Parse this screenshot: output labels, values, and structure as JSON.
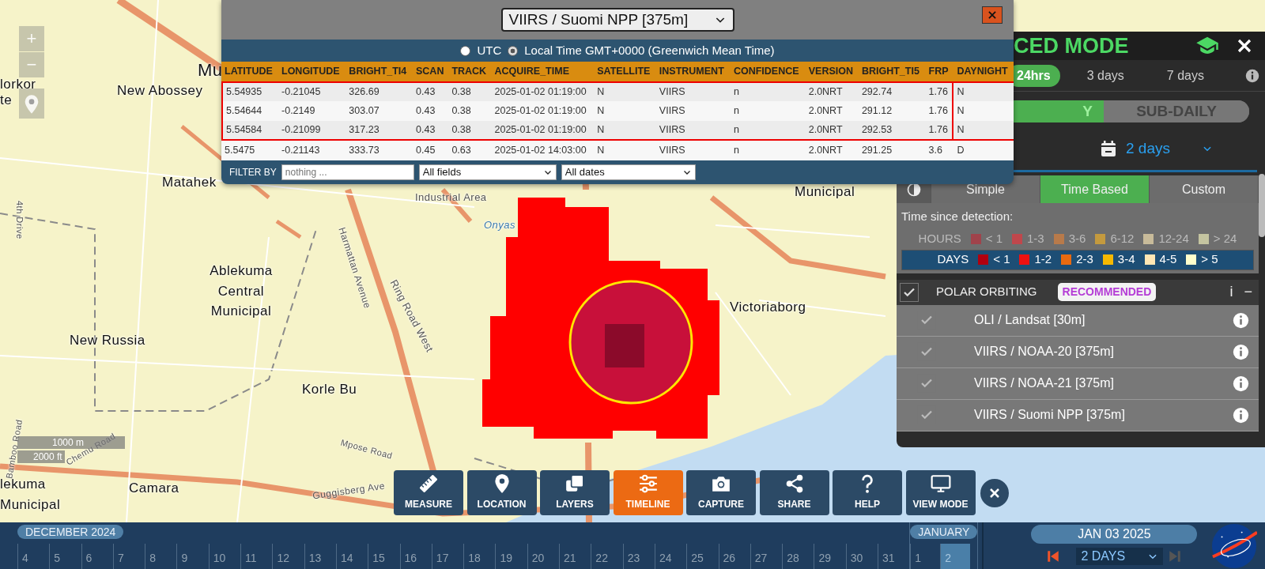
{
  "map": {
    "labels": [
      "Mu",
      "lorkor",
      "te",
      "New Abossey",
      "Matahek",
      "Ablekuma Central Municipal",
      "New Russia",
      "Korle Bu",
      "Camara",
      "lekuma Municipal",
      "Industrial Area",
      "Onyas",
      "Municipal",
      "Victoriaborg",
      "Ring Road West",
      "Harmattan Avenue",
      "4th Drive",
      "Chemu Road",
      "Mpose Road",
      "Guggisberg Ave",
      "Bamboo Road"
    ],
    "zoom_controls": [
      "+",
      "−"
    ],
    "scale": [
      "1000 m",
      "2000 ft"
    ]
  },
  "popup": {
    "source": "VIIRS / Suomi NPP [375m]",
    "time_modes": [
      {
        "label": "UTC",
        "selected": false
      },
      {
        "label": "Local Time GMT+0000 (Greenwich Mean Time)",
        "selected": true
      }
    ],
    "columns": [
      "LATITUDE",
      "LONGITUDE",
      "BRIGHT_TI4",
      "SCAN",
      "TRACK",
      "ACQUIRE_TIME",
      "SATELLITE",
      "INSTRUMENT",
      "CONFIDENCE",
      "VERSION",
      "BRIGHT_TI5",
      "FRP",
      "DAYNIGHT"
    ],
    "rows": [
      {
        "highlighted": true,
        "cells": [
          "5.54935",
          "-0.21045",
          "326.69",
          "0.43",
          "0.38",
          "2025-01-02 01:19:00",
          "N",
          "VIIRS",
          "n",
          "2.0NRT",
          "292.74",
          "1.76",
          "N"
        ]
      },
      {
        "highlighted": true,
        "cells": [
          "5.54644",
          "-0.2149",
          "303.07",
          "0.43",
          "0.38",
          "2025-01-02 01:19:00",
          "N",
          "VIIRS",
          "n",
          "2.0NRT",
          "291.12",
          "1.76",
          "N"
        ]
      },
      {
        "highlighted": true,
        "cells": [
          "5.54584",
          "-0.21099",
          "317.23",
          "0.43",
          "0.38",
          "2025-01-02 01:19:00",
          "N",
          "VIIRS",
          "n",
          "2.0NRT",
          "292.53",
          "1.76",
          "N"
        ]
      },
      {
        "highlighted": false,
        "cells": [
          "5.5475",
          "-0.21143",
          "333.73",
          "0.45",
          "0.63",
          "2025-01-02 14:03:00",
          "N",
          "VIIRS",
          "n",
          "2.0NRT",
          "291.25",
          "3.6",
          "D"
        ]
      }
    ],
    "filter": {
      "label": "FILTER BY",
      "placeholder": "nothing ...",
      "field": "All fields",
      "dates": "All dates"
    }
  },
  "panel": {
    "title": "CED MODE",
    "ranges": [
      {
        "label": "24hrs",
        "selected": true
      },
      {
        "label": "3 days",
        "selected": false
      },
      {
        "label": "7 days",
        "selected": false
      }
    ],
    "cadence": [
      {
        "label": "Y",
        "selected": true
      },
      {
        "label": "SUB-DAILY",
        "selected": false
      }
    ],
    "date_range": "2 days",
    "style_tabs": [
      {
        "label": "Simple",
        "selected": false
      },
      {
        "label": "Time Based",
        "selected": true
      },
      {
        "label": "Custom",
        "selected": false
      }
    ],
    "legend_title": "Time since detection:",
    "legend_rows": [
      {
        "label": "HOURS",
        "selected": false,
        "items": [
          {
            "label": "< 1",
            "color": "#a0434b"
          },
          {
            "label": "1-3",
            "color": "#c0474c"
          },
          {
            "label": "3-6",
            "color": "#b87a4a"
          },
          {
            "label": "6-12",
            "color": "#c49a3e"
          },
          {
            "label": "12-24",
            "color": "#c8bb9a"
          },
          {
            "label": "> 24",
            "color": "#c4c4a0"
          }
        ]
      },
      {
        "label": "DAYS",
        "selected": true,
        "items": [
          {
            "label": "< 1",
            "color": "#b0000f"
          },
          {
            "label": "1-2",
            "color": "#ee1111"
          },
          {
            "label": "2-3",
            "color": "#e86a10"
          },
          {
            "label": "3-4",
            "color": "#f5b800"
          },
          {
            "label": "4-5",
            "color": "#fde6b4"
          },
          {
            "label": "> 5",
            "color": "#ffffcc"
          }
        ]
      }
    ],
    "group": {
      "label": "POLAR ORBITING",
      "checked": true,
      "badge": "RECOMMENDED",
      "info": "i",
      "collapse": "−"
    },
    "sources": [
      {
        "label": "OLI / Landsat [30m]",
        "checked": true
      },
      {
        "label": "VIIRS / NOAA-20 [375m]",
        "checked": true
      },
      {
        "label": "VIIRS / NOAA-21 [375m]",
        "checked": true
      },
      {
        "label": "VIIRS / Suomi NPP [375m]",
        "checked": true
      }
    ]
  },
  "toolbar": [
    {
      "kind": "measure",
      "label": "MEASURE",
      "selected": false
    },
    {
      "kind": "location",
      "label": "LOCATION",
      "selected": false
    },
    {
      "kind": "layers",
      "label": "LAYERS",
      "selected": false
    },
    {
      "kind": "timeline",
      "label": "TIMELINE",
      "selected": true
    },
    {
      "kind": "capture",
      "label": "CAPTURE",
      "selected": false
    },
    {
      "kind": "share",
      "label": "SHARE",
      "selected": false
    },
    {
      "kind": "help",
      "label": "HELP",
      "selected": false
    },
    {
      "kind": "view",
      "label": "VIEW MODE",
      "selected": false
    }
  ],
  "timeline": {
    "months": [
      {
        "label": "DECEMBER 2024",
        "days": [
          {
            "label": "4",
            "selected": false
          },
          {
            "label": "5",
            "selected": false
          },
          {
            "label": "6",
            "selected": false
          },
          {
            "label": "7",
            "selected": false
          },
          {
            "label": "8",
            "selected": false
          },
          {
            "label": "9",
            "selected": false
          },
          {
            "label": "10",
            "selected": false
          },
          {
            "label": "11",
            "selected": false
          },
          {
            "label": "12",
            "selected": false
          },
          {
            "label": "13",
            "selected": false
          },
          {
            "label": "14",
            "selected": false
          },
          {
            "label": "15",
            "selected": false
          },
          {
            "label": "16",
            "selected": false
          },
          {
            "label": "17",
            "selected": false
          },
          {
            "label": "18",
            "selected": false
          },
          {
            "label": "19",
            "selected": false
          },
          {
            "label": "20",
            "selected": false
          },
          {
            "label": "21",
            "selected": false
          },
          {
            "label": "22",
            "selected": false
          },
          {
            "label": "23",
            "selected": false
          },
          {
            "label": "24",
            "selected": false
          },
          {
            "label": "25",
            "selected": false
          },
          {
            "label": "26",
            "selected": false
          },
          {
            "label": "27",
            "selected": false
          },
          {
            "label": "28",
            "selected": false
          },
          {
            "label": "29",
            "selected": false
          },
          {
            "label": "30",
            "selected": false
          },
          {
            "label": "31",
            "selected": false
          }
        ]
      },
      {
        "label": "JANUARY",
        "days": [
          {
            "label": "1",
            "selected": false
          },
          {
            "label": "2",
            "selected": true
          }
        ]
      }
    ],
    "date": "JAN 03 2025",
    "interval": "2 DAYS"
  }
}
